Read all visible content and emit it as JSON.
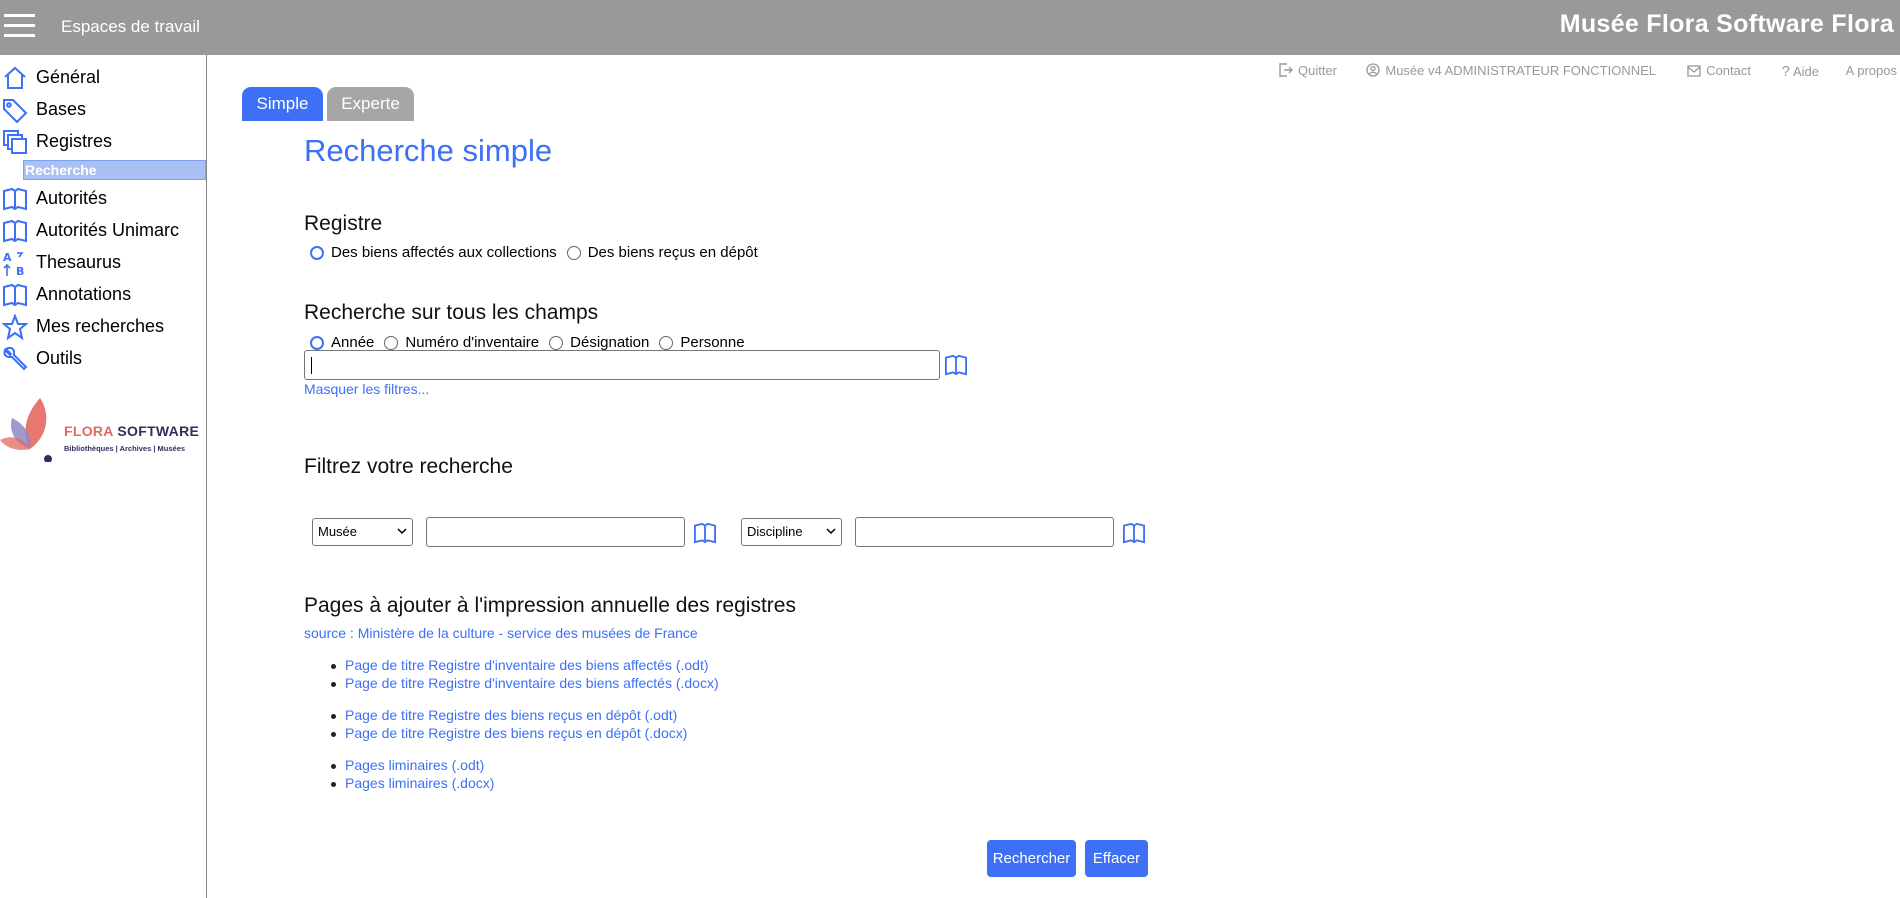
{
  "topbar": {
    "workspaces_label": "Espaces de travail",
    "brand": "Musée Flora Software Flora"
  },
  "sidebar": {
    "items": [
      {
        "label": "Général",
        "icon": "home-icon"
      },
      {
        "label": "Bases",
        "icon": "tag-icon"
      },
      {
        "label": "Registres",
        "icon": "registers-icon"
      },
      {
        "label": "Autorités",
        "icon": "book-icon"
      },
      {
        "label": "Autorités Unimarc",
        "icon": "book-icon"
      },
      {
        "label": "Thesaurus",
        "icon": "sort-az-icon"
      },
      {
        "label": "Annotations",
        "icon": "book-icon"
      },
      {
        "label": "Mes recherches",
        "icon": "star-icon"
      },
      {
        "label": "Outils",
        "icon": "wrench-icon"
      }
    ],
    "active_sub": "Recherche",
    "logo": {
      "brand_part1": "FLORA",
      "brand_part2": " SOFTWARE",
      "tagline": "Bibliothèques | Archives | Musées"
    }
  },
  "toplinks": {
    "quit": "Quitter",
    "user": "Musée v4 ADMINISTRATEUR FONCTIONNEL",
    "contact": "Contact",
    "help": "Aide",
    "about": "A propos"
  },
  "tabs": {
    "simple": "Simple",
    "expert": "Experte"
  },
  "page_title": "Recherche simple",
  "registre": {
    "heading": "Registre",
    "options": [
      "Des biens affectés aux collections",
      "Des biens reçus en dépôt"
    ],
    "selected": 0
  },
  "all_fields": {
    "heading": "Recherche sur tous les champs",
    "options": [
      "Année",
      "Numéro d'inventaire",
      "Désignation",
      "Personne"
    ],
    "selected": 0,
    "value": "",
    "hide_filters": "Masquer les filtres..."
  },
  "filters": {
    "heading": "Filtrez votre recherche",
    "select1": "Musée",
    "select2": "Discipline",
    "value1": "",
    "value2": ""
  },
  "annual": {
    "heading": "Pages à ajouter à l'impression annuelle des registres",
    "source": "source : Ministère de la culture - service des musées de France",
    "group1": [
      "Page de titre Registre d'inventaire des biens affectés (.odt)",
      "Page de titre Registre d'inventaire des biens affectés (.docx)"
    ],
    "group2": [
      "Page de titre Registre des biens reçus en dépôt (.odt)",
      "Page de titre Registre des biens reçus en dépôt (.docx)"
    ],
    "group3": [
      "Pages liminaires (.odt)",
      "Pages liminaires (.docx)"
    ]
  },
  "buttons": {
    "search": "Rechercher",
    "clear": "Effacer"
  },
  "colors": {
    "accent": "#3d70f5",
    "topbar": "#999999",
    "tab_inactive": "#a6a6a6",
    "logo_coral": "#e4685f",
    "logo_navy": "#2d2f5c"
  }
}
